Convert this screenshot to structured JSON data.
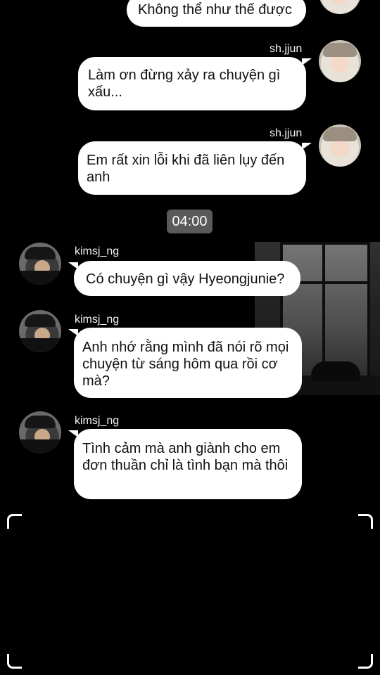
{
  "chat": {
    "time_divider": "04:00",
    "messages": [
      {
        "sender": "",
        "text": "Không thể như thế được"
      },
      {
        "sender": "sh.jjun",
        "text": "Làm ơn đừng xảy ra chuyện gì xấu..."
      },
      {
        "sender": "sh.jjun",
        "text": "Em rất xin lỗi khi đã liên lụy đến anh"
      },
      {
        "sender": "kimsj_ng",
        "text": "Có chuyện gì vậy Hyeongjunie?"
      },
      {
        "sender": "kimsj_ng",
        "text": "Anh nhớ rằng mình đã nói rõ mọi chuyện từ sáng hôm qua rồi cơ mà?"
      },
      {
        "sender": "kimsj_ng",
        "text": "Tình cảm mà anh giành cho em đơn thuần chỉ là tình bạn mà thôi"
      }
    ]
  }
}
